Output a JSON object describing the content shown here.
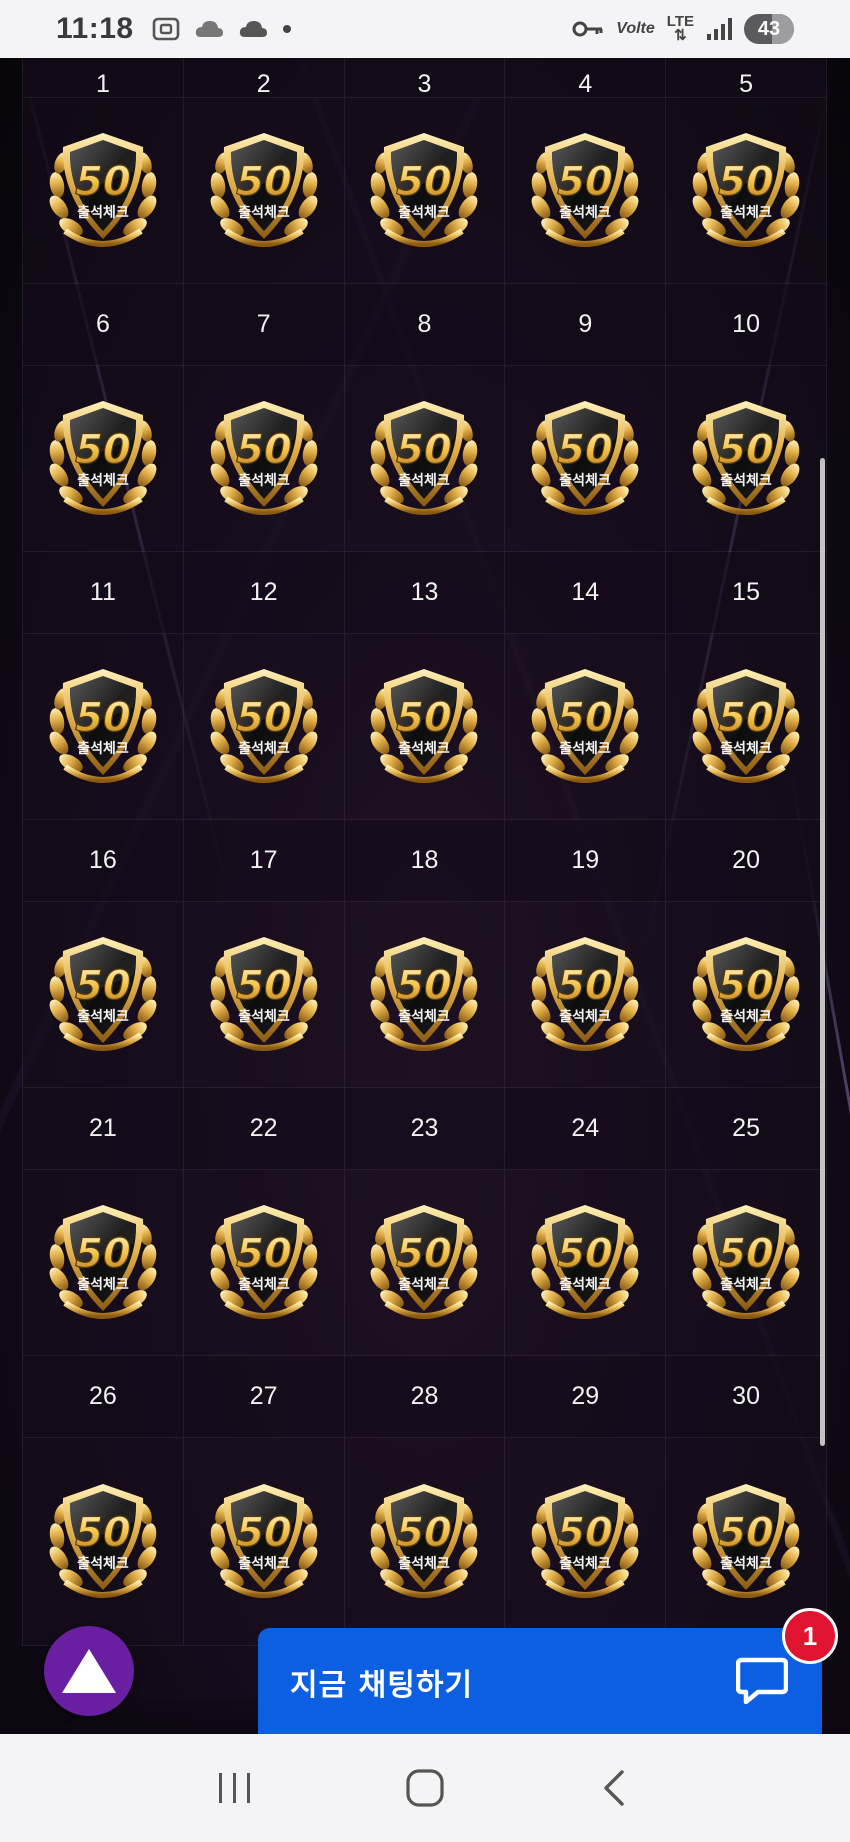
{
  "status_bar": {
    "time": "11:18",
    "left_icons": [
      "screenshot-icon",
      "cloud-icon",
      "cloud-icon",
      "dot-icon"
    ],
    "right_icons": [
      "key-icon",
      "volte-icon",
      "lte-icon",
      "signal-icon"
    ],
    "volte_label": "Volte",
    "lte_label": "LTE",
    "battery": "43"
  },
  "calendar": {
    "badge_number": "50",
    "badge_text": "출석체크",
    "weeks": [
      {
        "days": [
          "1",
          "2",
          "3",
          "4",
          "5"
        ]
      },
      {
        "days": [
          "6",
          "7",
          "8",
          "9",
          "10"
        ]
      },
      {
        "days": [
          "11",
          "12",
          "13",
          "14",
          "15"
        ]
      },
      {
        "days": [
          "16",
          "17",
          "18",
          "19",
          "20"
        ]
      },
      {
        "days": [
          "21",
          "22",
          "23",
          "24",
          "25"
        ]
      },
      {
        "days": [
          "26",
          "27",
          "28",
          "29",
          "30"
        ]
      }
    ]
  },
  "chat": {
    "label": "지금 채팅하기",
    "unread_count": "1"
  },
  "nav": {
    "buttons": [
      "recent-apps-icon",
      "home-icon",
      "back-icon"
    ]
  },
  "colors": {
    "chat_blue": "#0b5fe0",
    "top_button_purple": "#6a1fa3",
    "badge_red": "#e01330",
    "gold": "#d9a53a"
  }
}
